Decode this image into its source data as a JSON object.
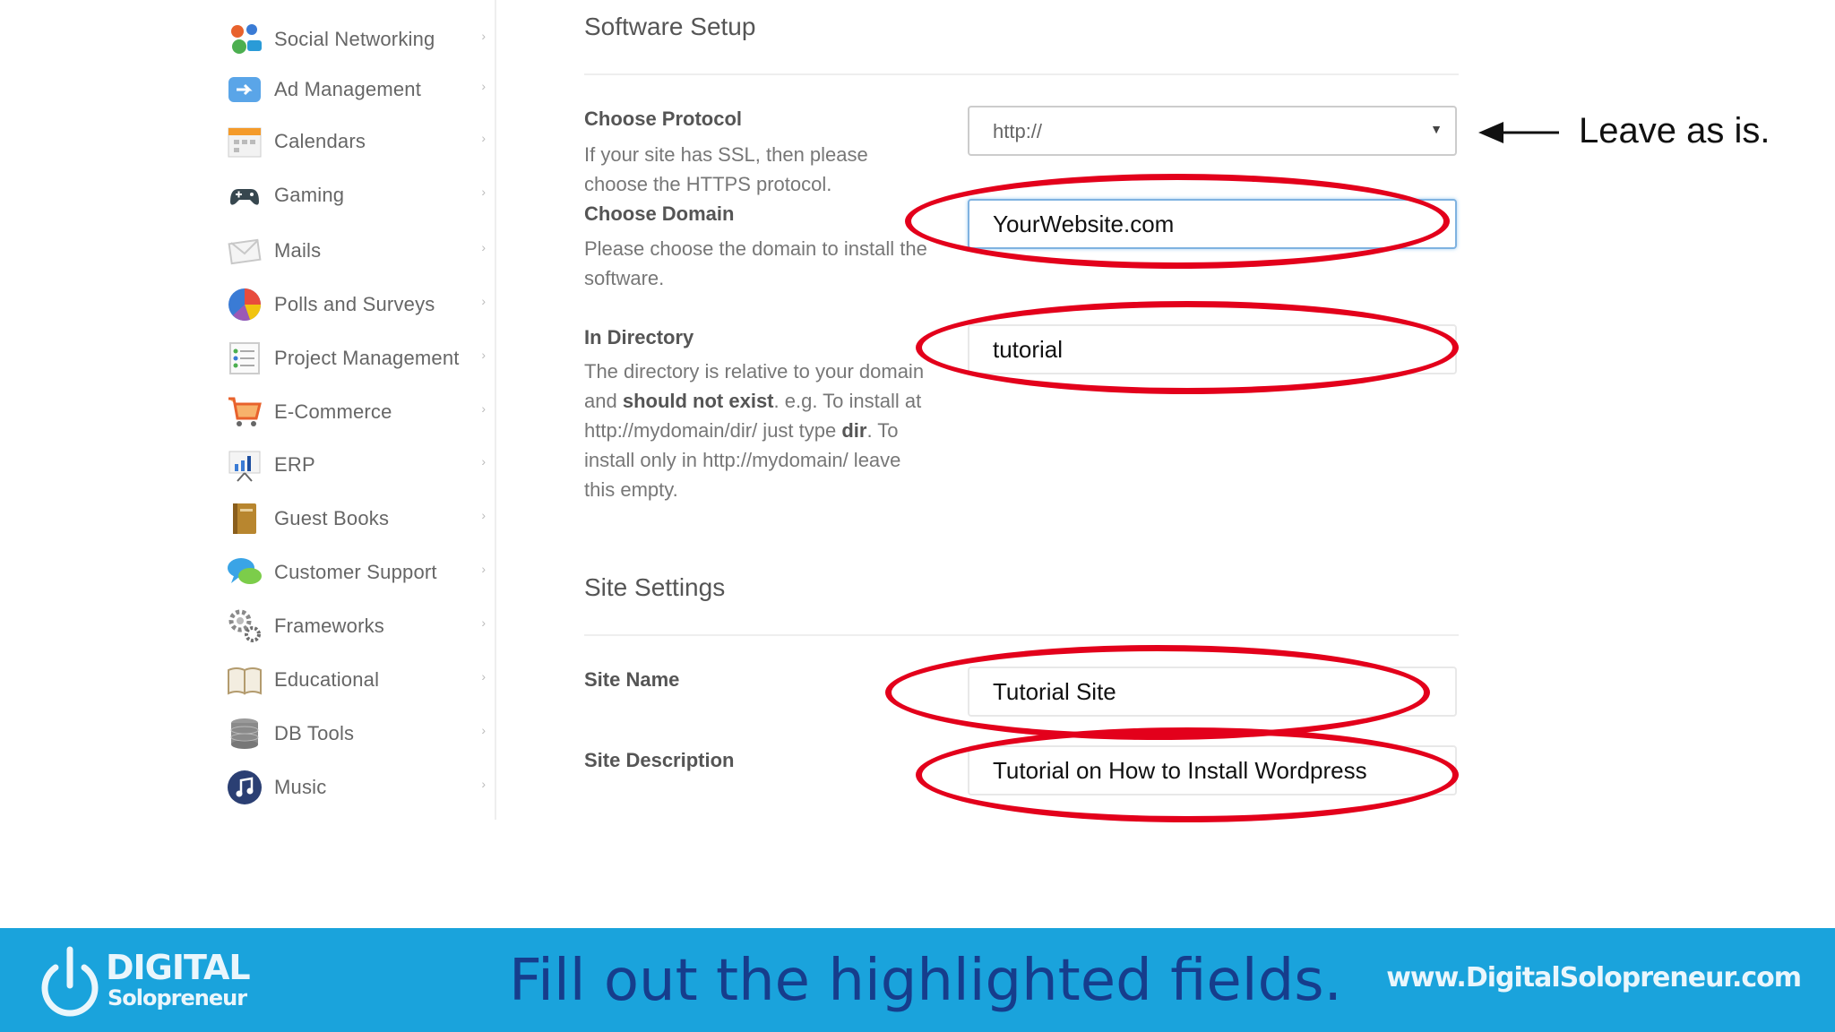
{
  "sidebar": {
    "items": [
      {
        "label": "Social Networking",
        "icon": "social-networking-icon"
      },
      {
        "label": "Ad Management",
        "icon": "ad-management-icon"
      },
      {
        "label": "Calendars",
        "icon": "calendar-icon"
      },
      {
        "label": "Gaming",
        "icon": "gamepad-icon"
      },
      {
        "label": "Mails",
        "icon": "mail-icon"
      },
      {
        "label": "Polls and Surveys",
        "icon": "pie-chart-icon"
      },
      {
        "label": "Project Management",
        "icon": "checklist-icon"
      },
      {
        "label": "E-Commerce",
        "icon": "shopping-cart-icon"
      },
      {
        "label": "ERP",
        "icon": "bar-chart-icon"
      },
      {
        "label": "Guest Books",
        "icon": "book-icon"
      },
      {
        "label": "Customer Support",
        "icon": "chat-bubbles-icon"
      },
      {
        "label": "Frameworks",
        "icon": "gears-icon"
      },
      {
        "label": "Educational",
        "icon": "open-book-icon"
      },
      {
        "label": "DB Tools",
        "icon": "database-icon"
      },
      {
        "label": "Music",
        "icon": "music-icon"
      }
    ],
    "chevron": "›"
  },
  "software_setup": {
    "title": "Software Setup",
    "protocol": {
      "label": "Choose Protocol",
      "help": "If your site has SSL, then please choose the HTTPS protocol.",
      "value": "http://"
    },
    "domain": {
      "label": "Choose Domain",
      "help": "Please choose the domain to install the software.",
      "value": "YourWebsite.com"
    },
    "directory": {
      "label": "In Directory",
      "help_1": "The directory is relative to your domain and ",
      "help_bold_1": "should not exist",
      "help_2": ". e.g. To install at http://mydomain/dir/ just type ",
      "help_bold_2": "dir",
      "help_3": ". To install only in http://mydomain/ leave this empty.",
      "value": "tutorial"
    }
  },
  "site_settings": {
    "title": "Site Settings",
    "site_name": {
      "label": "Site Name",
      "value": "Tutorial Site"
    },
    "site_description": {
      "label": "Site Description",
      "value": "Tutorial on How to Install Wordpress"
    }
  },
  "annotation": {
    "note": "Leave as is."
  },
  "footer": {
    "logo_word1": "DIGITAL",
    "logo_word2": "Solopreneur",
    "tagline": "Fill out the highlighted fields.",
    "url": "www.DigitalSolopreneur.com"
  },
  "colors": {
    "banner": "#1aa3dc",
    "tagline": "#163d8c",
    "highlight_ellipse": "#e3001b"
  }
}
